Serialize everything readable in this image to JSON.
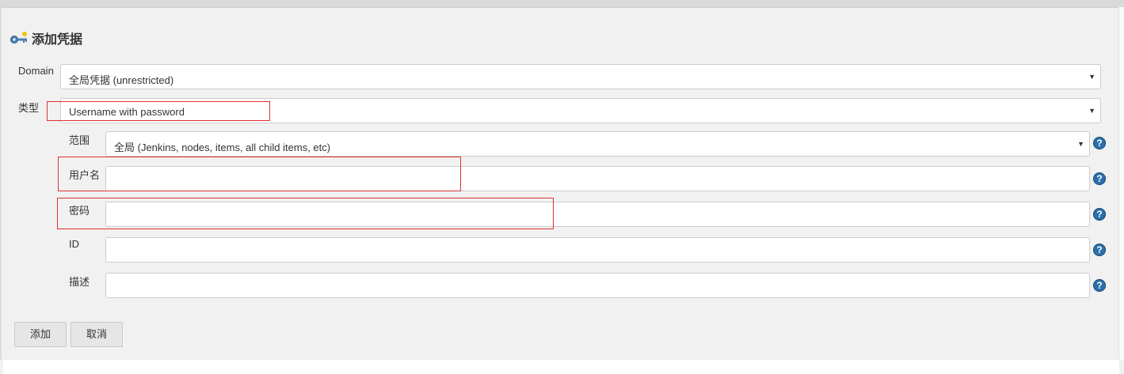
{
  "page": {
    "title": "添加凭据",
    "title_icon": "credentials-key-icon"
  },
  "form": {
    "domain": {
      "label": "Domain",
      "value": "全局凭据 (unrestricted)"
    },
    "kind": {
      "label": "类型",
      "value": "Username with password"
    },
    "scope": {
      "label": "范围",
      "value": "全局 (Jenkins, nodes, items, all child items, etc)"
    },
    "username": {
      "label": "用户名",
      "value": ""
    },
    "password": {
      "label": "密码",
      "value": ""
    },
    "id": {
      "label": "ID",
      "value": ""
    },
    "description": {
      "label": "描述",
      "value": ""
    },
    "help_icon": "help-icon",
    "help_glyph": "?"
  },
  "buttons": {
    "add": "添加",
    "cancel": "取消"
  },
  "colors": {
    "annotation_red": "#e03131",
    "help_blue": "#2c6ea8"
  }
}
